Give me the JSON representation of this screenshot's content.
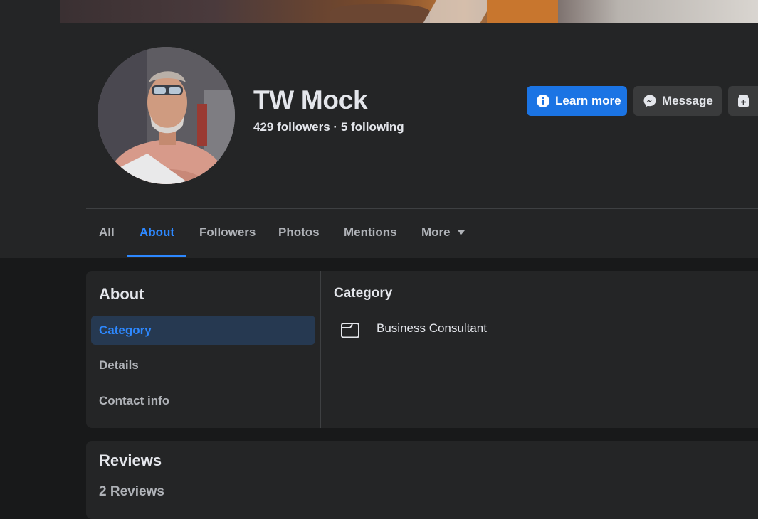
{
  "profile": {
    "name": "TW Mock",
    "followers_line": "429 followers · 5 following"
  },
  "actions": {
    "learn_more": "Learn more",
    "message": "Message"
  },
  "tabs": [
    {
      "label": "All"
    },
    {
      "label": "About",
      "active": true
    },
    {
      "label": "Followers"
    },
    {
      "label": "Photos"
    },
    {
      "label": "Mentions"
    },
    {
      "label": "More"
    }
  ],
  "about": {
    "title": "About",
    "sidebar": [
      {
        "label": "Category",
        "active": true
      },
      {
        "label": "Details"
      },
      {
        "label": "Contact info"
      }
    ],
    "section_title": "Category",
    "category_value": "Business Consultant"
  },
  "reviews": {
    "title": "Reviews",
    "count": "2 Reviews"
  },
  "icons": {
    "learn_more": "info-icon",
    "message": "messenger-icon",
    "more_action": "add-page-icon",
    "tab_more": "caret-down-icon",
    "category": "folder-icon"
  },
  "colors": {
    "accent": "#1b74e4",
    "active_tab": "#2d88ff",
    "active_side_bg": "#263951"
  }
}
